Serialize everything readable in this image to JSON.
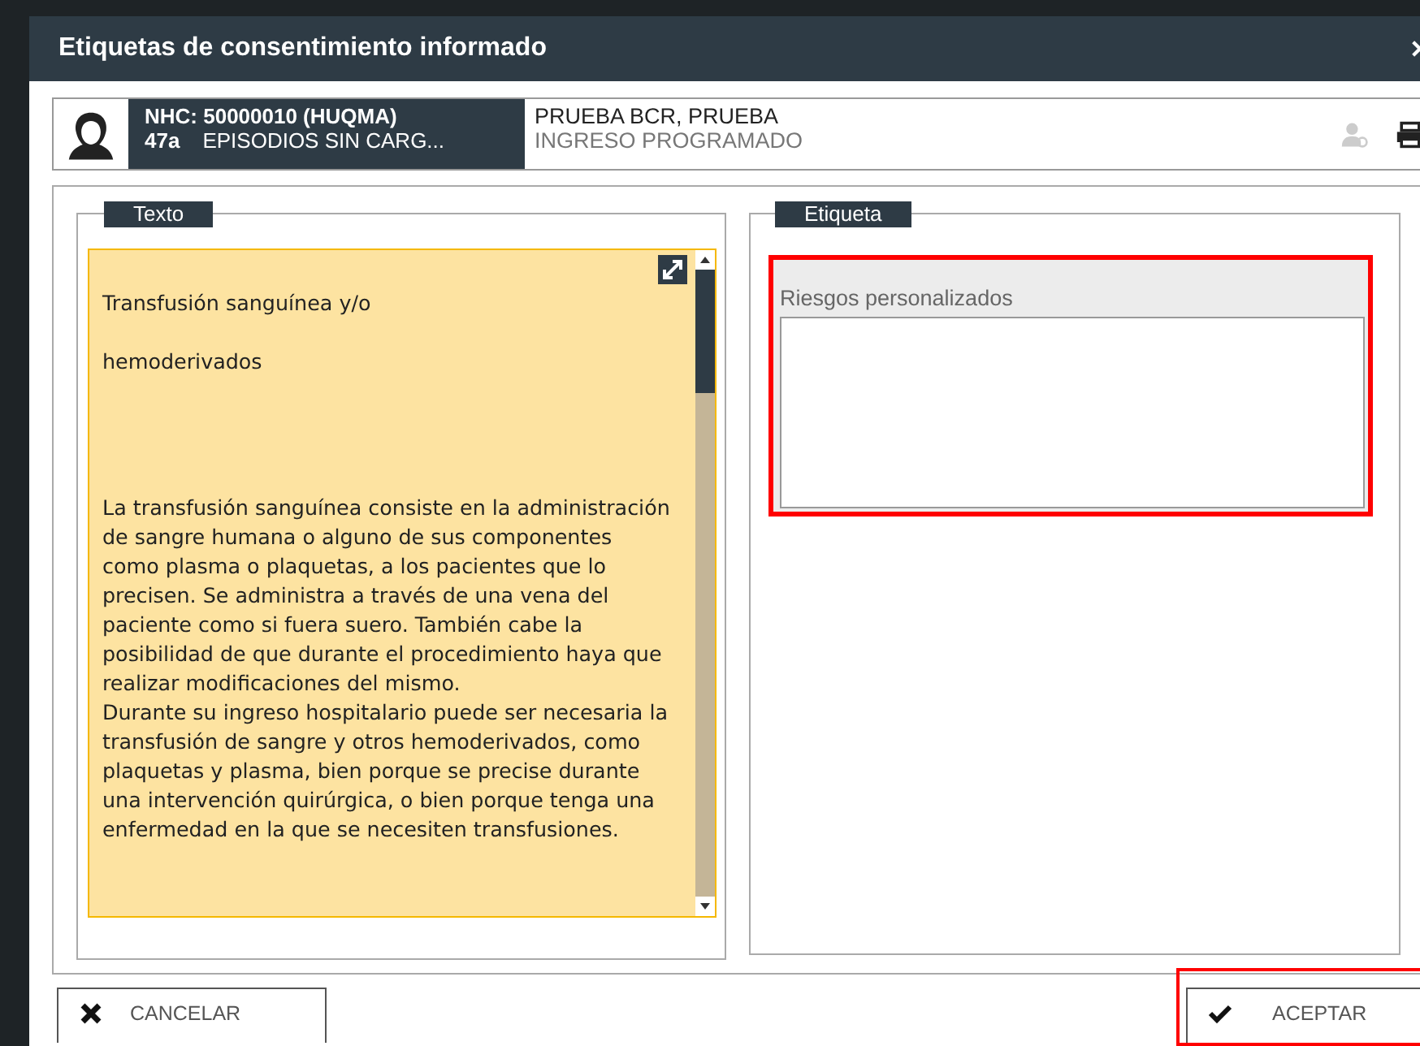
{
  "window": {
    "title": "Etiquetas de consentimiento informado"
  },
  "patient": {
    "nhc": "NHC: 50000010 (HUQMA)",
    "age": "47a",
    "episodes": "EPISODIOS SIN CARG...",
    "name": "PRUEBA BCR, PRUEBA",
    "admission": "INGRESO PROGRAMADO"
  },
  "text_panel": {
    "legend": "Texto",
    "paragraphs": [
      "Transfusión sanguínea y/o",
      "hemoderivados",
      "La transfusión sanguínea consiste en la administración de sangre humana o alguno de sus componentes como plasma o plaquetas, a los pacientes que lo precisen. Se administra a través de una vena del paciente como si fuera suero. También cabe la posibilidad de que durante el procedimiento haya que realizar modificaciones del mismo.",
      "Durante su ingreso hospitalario puede ser necesaria la transfusión de sangre y otros hemoderivados, como plaquetas y plasma, bien porque se precise durante una intervención quirúrgica, o bien porque tenga una enfermedad en la que se necesiten transfusiones."
    ]
  },
  "label_panel": {
    "legend": "Etiqueta",
    "field": {
      "label": "Riesgos personalizados",
      "highlighted": true
    }
  },
  "buttons": [
    {
      "label": "CANCELAR",
      "kind": "cancel",
      "highlighted": false
    },
    {
      "label": "ACEPTAR",
      "kind": "accept",
      "highlighted": true
    }
  ]
}
